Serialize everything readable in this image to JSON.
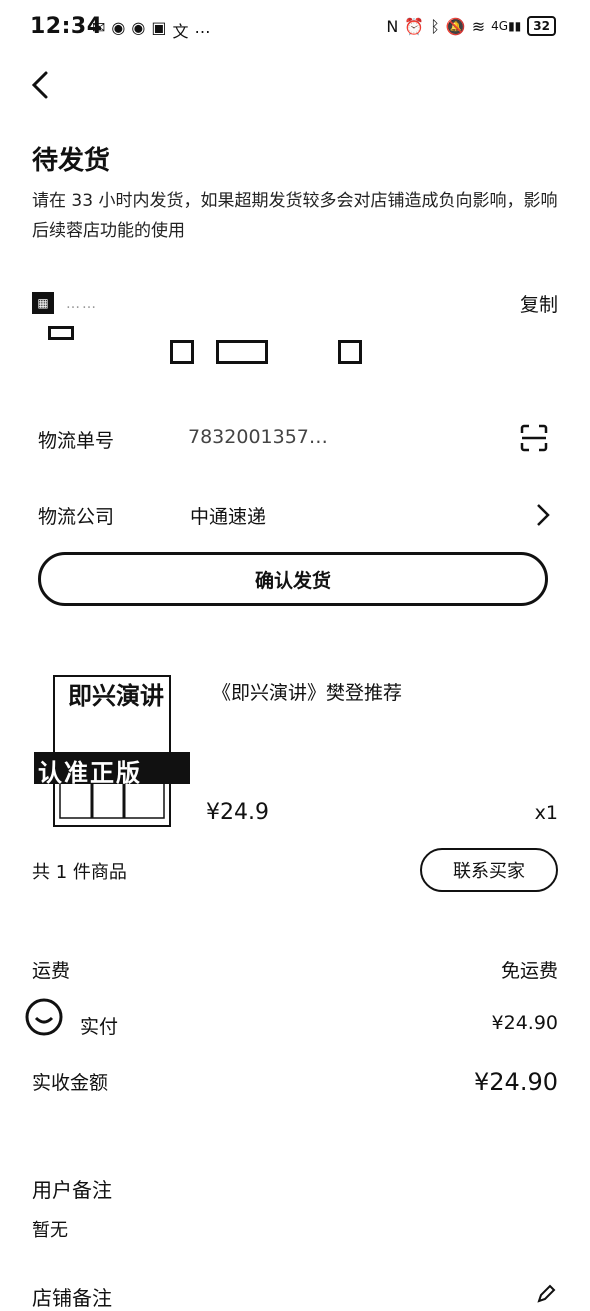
{
  "status_bar": {
    "time": "12:34",
    "battery": "32",
    "network": "4G"
  },
  "header": {
    "title": "待发货",
    "description": "请在 33 小时内发货，如果超期发货较多会对店铺造成负向影响，影响后续蓉店功能的使用"
  },
  "address": {
    "copy_label": "复制",
    "blurred_text": "……"
  },
  "logistics": {
    "tracking_label": "物流单号",
    "tracking_value": "7832001357…",
    "company_label": "物流公司",
    "company_value": "中通速递"
  },
  "confirm_button": "确认发货",
  "product": {
    "title": "《即兴演讲》樊登推荐",
    "price": "¥24.9",
    "qty": "x1",
    "image_text_top": "即兴演讲",
    "image_badge": "认准正版"
  },
  "order_summary": {
    "count": "共 1 件商品",
    "contact_button": "联系买家",
    "shipping_label": "运费",
    "shipping_value": "免运费",
    "paid_label": "实付",
    "paid_value": "¥24.90",
    "received_label": "实收金额",
    "received_value": "¥24.90"
  },
  "notes": {
    "user_label": "用户备注",
    "user_value": "暂无",
    "shop_label": "店铺备注"
  }
}
